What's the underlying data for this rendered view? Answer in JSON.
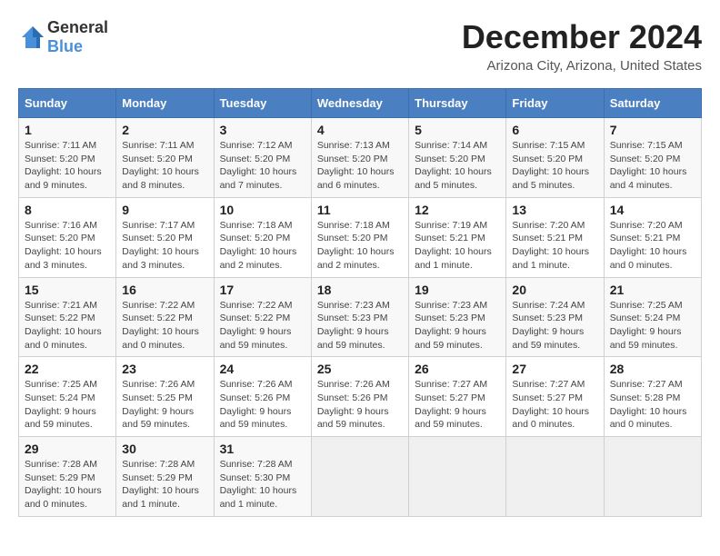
{
  "header": {
    "logo_general": "General",
    "logo_blue": "Blue",
    "title": "December 2024",
    "subtitle": "Arizona City, Arizona, United States"
  },
  "calendar": {
    "days_of_week": [
      "Sunday",
      "Monday",
      "Tuesday",
      "Wednesday",
      "Thursday",
      "Friday",
      "Saturday"
    ],
    "weeks": [
      [
        {
          "day": "",
          "empty": true
        },
        {
          "day": "",
          "empty": true
        },
        {
          "day": "",
          "empty": true
        },
        {
          "day": "",
          "empty": true
        },
        {
          "day": "5",
          "sunrise": "Sunrise: 7:14 AM",
          "sunset": "Sunset: 5:20 PM",
          "daylight": "Daylight: 10 hours and 5 minutes."
        },
        {
          "day": "6",
          "sunrise": "Sunrise: 7:15 AM",
          "sunset": "Sunset: 5:20 PM",
          "daylight": "Daylight: 10 hours and 5 minutes."
        },
        {
          "day": "7",
          "sunrise": "Sunrise: 7:15 AM",
          "sunset": "Sunset: 5:20 PM",
          "daylight": "Daylight: 10 hours and 4 minutes."
        }
      ],
      [
        {
          "day": "1",
          "sunrise": "Sunrise: 7:11 AM",
          "sunset": "Sunset: 5:20 PM",
          "daylight": "Daylight: 10 hours and 9 minutes."
        },
        {
          "day": "2",
          "sunrise": "Sunrise: 7:11 AM",
          "sunset": "Sunset: 5:20 PM",
          "daylight": "Daylight: 10 hours and 8 minutes."
        },
        {
          "day": "3",
          "sunrise": "Sunrise: 7:12 AM",
          "sunset": "Sunset: 5:20 PM",
          "daylight": "Daylight: 10 hours and 7 minutes."
        },
        {
          "day": "4",
          "sunrise": "Sunrise: 7:13 AM",
          "sunset": "Sunset: 5:20 PM",
          "daylight": "Daylight: 10 hours and 6 minutes."
        },
        {
          "day": "",
          "empty": true
        },
        {
          "day": "",
          "empty": true
        },
        {
          "day": "",
          "empty": true
        }
      ],
      [
        {
          "day": "8",
          "sunrise": "Sunrise: 7:16 AM",
          "sunset": "Sunset: 5:20 PM",
          "daylight": "Daylight: 10 hours and 3 minutes."
        },
        {
          "day": "9",
          "sunrise": "Sunrise: 7:17 AM",
          "sunset": "Sunset: 5:20 PM",
          "daylight": "Daylight: 10 hours and 3 minutes."
        },
        {
          "day": "10",
          "sunrise": "Sunrise: 7:18 AM",
          "sunset": "Sunset: 5:20 PM",
          "daylight": "Daylight: 10 hours and 2 minutes."
        },
        {
          "day": "11",
          "sunrise": "Sunrise: 7:18 AM",
          "sunset": "Sunset: 5:20 PM",
          "daylight": "Daylight: 10 hours and 2 minutes."
        },
        {
          "day": "12",
          "sunrise": "Sunrise: 7:19 AM",
          "sunset": "Sunset: 5:21 PM",
          "daylight": "Daylight: 10 hours and 1 minute."
        },
        {
          "day": "13",
          "sunrise": "Sunrise: 7:20 AM",
          "sunset": "Sunset: 5:21 PM",
          "daylight": "Daylight: 10 hours and 1 minute."
        },
        {
          "day": "14",
          "sunrise": "Sunrise: 7:20 AM",
          "sunset": "Sunset: 5:21 PM",
          "daylight": "Daylight: 10 hours and 0 minutes."
        }
      ],
      [
        {
          "day": "15",
          "sunrise": "Sunrise: 7:21 AM",
          "sunset": "Sunset: 5:22 PM",
          "daylight": "Daylight: 10 hours and 0 minutes."
        },
        {
          "day": "16",
          "sunrise": "Sunrise: 7:22 AM",
          "sunset": "Sunset: 5:22 PM",
          "daylight": "Daylight: 10 hours and 0 minutes."
        },
        {
          "day": "17",
          "sunrise": "Sunrise: 7:22 AM",
          "sunset": "Sunset: 5:22 PM",
          "daylight": "Daylight: 9 hours and 59 minutes."
        },
        {
          "day": "18",
          "sunrise": "Sunrise: 7:23 AM",
          "sunset": "Sunset: 5:23 PM",
          "daylight": "Daylight: 9 hours and 59 minutes."
        },
        {
          "day": "19",
          "sunrise": "Sunrise: 7:23 AM",
          "sunset": "Sunset: 5:23 PM",
          "daylight": "Daylight: 9 hours and 59 minutes."
        },
        {
          "day": "20",
          "sunrise": "Sunrise: 7:24 AM",
          "sunset": "Sunset: 5:23 PM",
          "daylight": "Daylight: 9 hours and 59 minutes."
        },
        {
          "day": "21",
          "sunrise": "Sunrise: 7:25 AM",
          "sunset": "Sunset: 5:24 PM",
          "daylight": "Daylight: 9 hours and 59 minutes."
        }
      ],
      [
        {
          "day": "22",
          "sunrise": "Sunrise: 7:25 AM",
          "sunset": "Sunset: 5:24 PM",
          "daylight": "Daylight: 9 hours and 59 minutes."
        },
        {
          "day": "23",
          "sunrise": "Sunrise: 7:26 AM",
          "sunset": "Sunset: 5:25 PM",
          "daylight": "Daylight: 9 hours and 59 minutes."
        },
        {
          "day": "24",
          "sunrise": "Sunrise: 7:26 AM",
          "sunset": "Sunset: 5:26 PM",
          "daylight": "Daylight: 9 hours and 59 minutes."
        },
        {
          "day": "25",
          "sunrise": "Sunrise: 7:26 AM",
          "sunset": "Sunset: 5:26 PM",
          "daylight": "Daylight: 9 hours and 59 minutes."
        },
        {
          "day": "26",
          "sunrise": "Sunrise: 7:27 AM",
          "sunset": "Sunset: 5:27 PM",
          "daylight": "Daylight: 9 hours and 59 minutes."
        },
        {
          "day": "27",
          "sunrise": "Sunrise: 7:27 AM",
          "sunset": "Sunset: 5:27 PM",
          "daylight": "Daylight: 10 hours and 0 minutes."
        },
        {
          "day": "28",
          "sunrise": "Sunrise: 7:27 AM",
          "sunset": "Sunset: 5:28 PM",
          "daylight": "Daylight: 10 hours and 0 minutes."
        }
      ],
      [
        {
          "day": "29",
          "sunrise": "Sunrise: 7:28 AM",
          "sunset": "Sunset: 5:29 PM",
          "daylight": "Daylight: 10 hours and 0 minutes."
        },
        {
          "day": "30",
          "sunrise": "Sunrise: 7:28 AM",
          "sunset": "Sunset: 5:29 PM",
          "daylight": "Daylight: 10 hours and 1 minute."
        },
        {
          "day": "31",
          "sunrise": "Sunrise: 7:28 AM",
          "sunset": "Sunset: 5:30 PM",
          "daylight": "Daylight: 10 hours and 1 minute."
        },
        {
          "day": "",
          "empty": true
        },
        {
          "day": "",
          "empty": true
        },
        {
          "day": "",
          "empty": true
        },
        {
          "day": "",
          "empty": true
        }
      ]
    ]
  }
}
